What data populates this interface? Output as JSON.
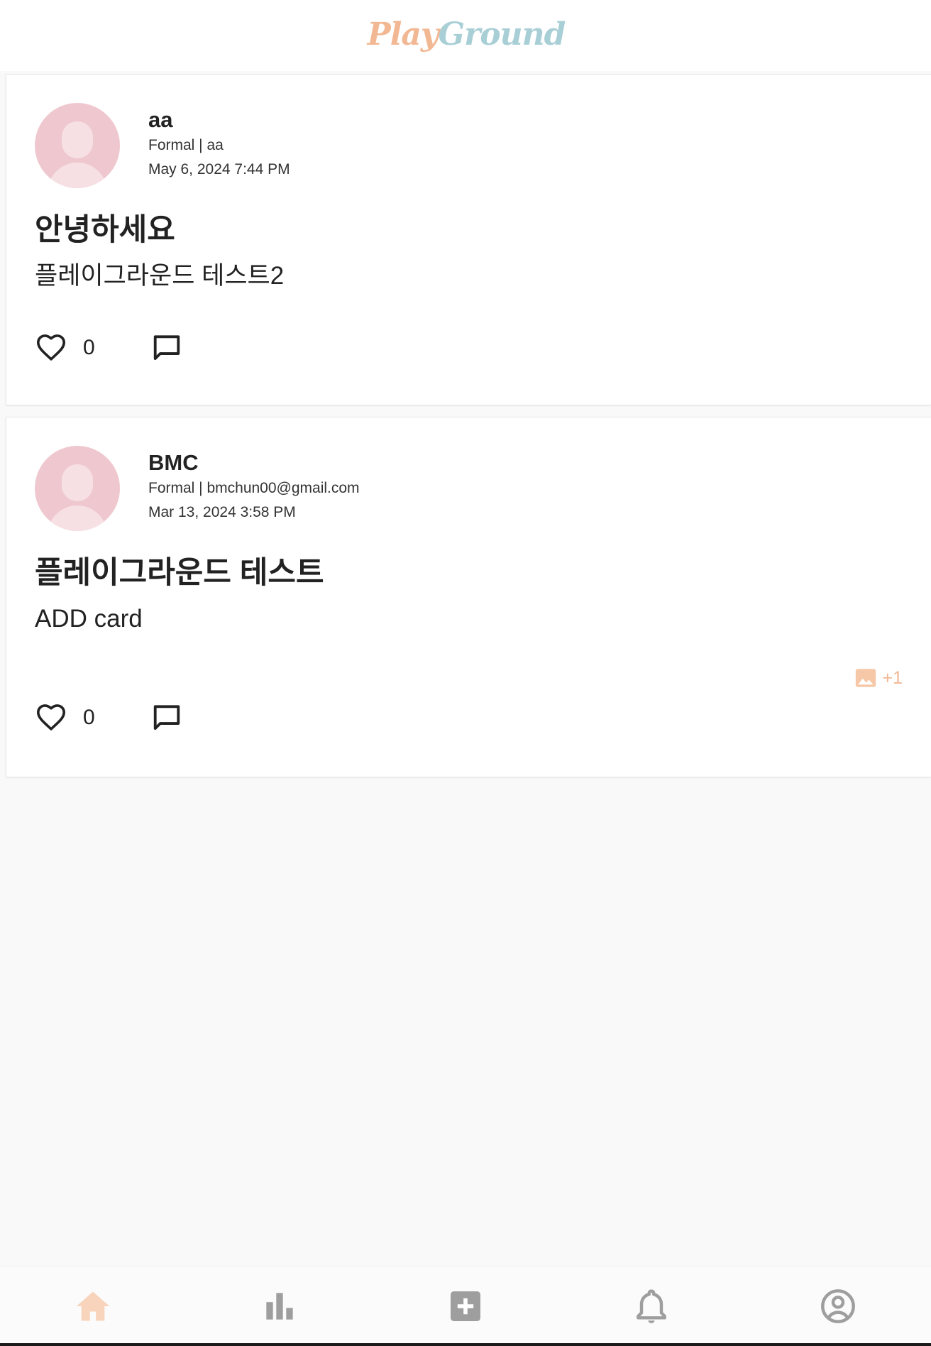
{
  "header": {
    "logo_part1": "Play",
    "logo_part2": "Ground"
  },
  "posts": [
    {
      "author": "aa",
      "subtitle": "Formal | aa",
      "date": "May 6, 2024 7:44 PM",
      "title": "안녕하세요",
      "body": "플레이그라운드 테스트2",
      "likes": "0"
    },
    {
      "author": "BMC",
      "subtitle": "Formal | bmchun00@gmail.com",
      "date": "Mar 13, 2024 3:58 PM",
      "title": "플레이그라운드 테스트",
      "body": "ADD card",
      "likes": "0",
      "image_badge": "+1"
    }
  ],
  "icons": {
    "like": "heart-outline-icon",
    "comment": "comment-outline-icon",
    "image": "image-icon"
  },
  "bottom_nav": [
    {
      "name": "home",
      "icon": "home-icon",
      "active": true
    },
    {
      "name": "stats",
      "icon": "bar-chart-icon",
      "active": false
    },
    {
      "name": "add",
      "icon": "add-box-icon",
      "active": false
    },
    {
      "name": "notifications",
      "icon": "bell-icon",
      "active": false
    },
    {
      "name": "profile",
      "icon": "account-circle-icon",
      "active": false
    }
  ],
  "colors": {
    "accent": "#f2b893",
    "logo_secondary": "#a9cfd6",
    "avatar_bg": "#efc8cf",
    "nav_active": "#f8d4bc",
    "nav_inactive": "#9e9e9e"
  }
}
